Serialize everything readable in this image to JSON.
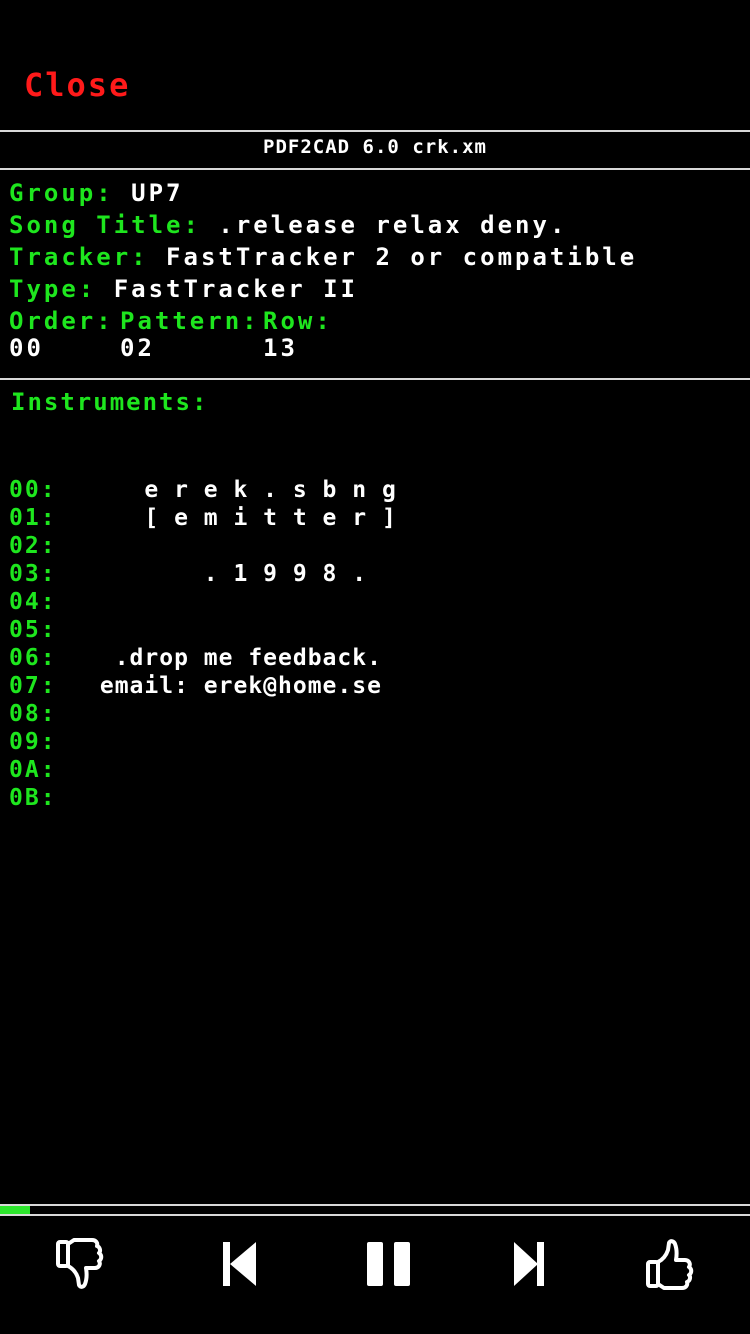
{
  "header": {
    "close_label": "Close",
    "file_title": "PDF2CAD 6.0 crk.xm"
  },
  "info": {
    "group_label": "Group:",
    "group_value": "UP7",
    "song_title_label": "Song Title:",
    "song_title_value": ".release relax deny.",
    "tracker_label": "Tracker:",
    "tracker_value": "FastTracker 2 or compatible",
    "type_label": "Type:",
    "type_value": "FastTracker II",
    "order_label": "Order:",
    "pattern_label": "Pattern:",
    "row_label": "Row:",
    "order_value": "00",
    "pattern_value": "02",
    "row_value": "13"
  },
  "instruments": {
    "heading": "Instruments:",
    "items": [
      {
        "index": "00:",
        "name": "    e r e k . s b n g"
      },
      {
        "index": "01:",
        "name": "    [ e m i t t e r ]"
      },
      {
        "index": "02:",
        "name": ""
      },
      {
        "index": "03:",
        "name": "        . 1 9 9 8 ."
      },
      {
        "index": "04:",
        "name": ""
      },
      {
        "index": "05:",
        "name": ""
      },
      {
        "index": "06:",
        "name": "  .drop me feedback."
      },
      {
        "index": "07:",
        "name": " email: erek@home.se"
      },
      {
        "index": "08:",
        "name": ""
      },
      {
        "index": "09:",
        "name": ""
      },
      {
        "index": "0A:",
        "name": ""
      },
      {
        "index": "0B:",
        "name": ""
      }
    ]
  },
  "player": {
    "progress": 0.04,
    "accent_color": "#2ee62e",
    "buttons": {
      "dislike": "thumbs-down-icon",
      "previous": "skip-previous-icon",
      "pause": "pause-icon",
      "next": "skip-next-icon",
      "like": "thumbs-up-icon"
    }
  }
}
